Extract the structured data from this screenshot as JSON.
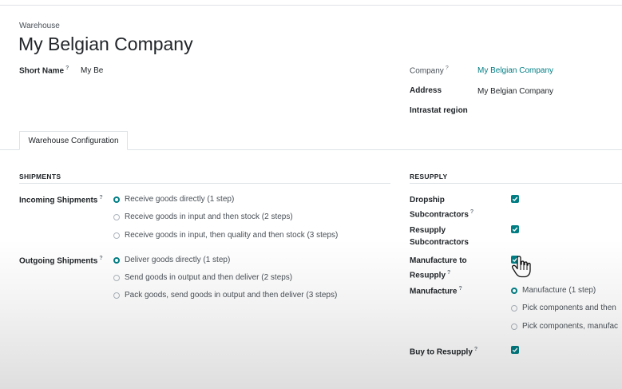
{
  "header": {
    "breadcrumb": "Warehouse",
    "title": "My Belgian Company"
  },
  "fields": {
    "short_name_label": "Short Name",
    "short_name_value": "My Be",
    "company_label": "Company",
    "company_value": "My Belgian Company",
    "address_label": "Address",
    "address_value": "My Belgian Company",
    "intrastat_label": "Intrastat region",
    "help_mark": "?"
  },
  "tabs": [
    {
      "label": "Warehouse Configuration"
    }
  ],
  "shipments": {
    "title": "SHIPMENTS",
    "incoming_label": "Incoming Shipments",
    "incoming_options": [
      "Receive goods directly (1 step)",
      "Receive goods in input and then stock (2 steps)",
      "Receive goods in input, then quality and then stock (3 steps)"
    ],
    "incoming_selected": 0,
    "outgoing_label": "Outgoing Shipments",
    "outgoing_options": [
      "Deliver goods directly (1 step)",
      "Send goods in output and then deliver (2 steps)",
      "Pack goods, send goods in output and then deliver (3 steps)"
    ],
    "outgoing_selected": 0
  },
  "resupply": {
    "title": "RESUPPLY",
    "dropship_label_1": "Dropship",
    "dropship_label_2": "Subcontractors",
    "dropship_checked": true,
    "resupply_sub_label_1": "Resupply",
    "resupply_sub_label_2": "Subcontractors",
    "resupply_sub_checked": true,
    "manufacture_to_resupply_label_1": "Manufacture to",
    "manufacture_to_resupply_label_2": "Resupply",
    "manufacture_to_resupply_checked": true,
    "manufacture_label": "Manufacture",
    "manufacture_options": [
      "Manufacture (1 step)",
      "Pick components and then",
      "Pick components, manufac"
    ],
    "manufacture_selected": 0,
    "buy_label": "Buy to Resupply",
    "buy_checked": true
  },
  "colors": {
    "accent": "#017e84",
    "text": "#212529",
    "muted": "#495057",
    "border": "#dee2e6"
  }
}
